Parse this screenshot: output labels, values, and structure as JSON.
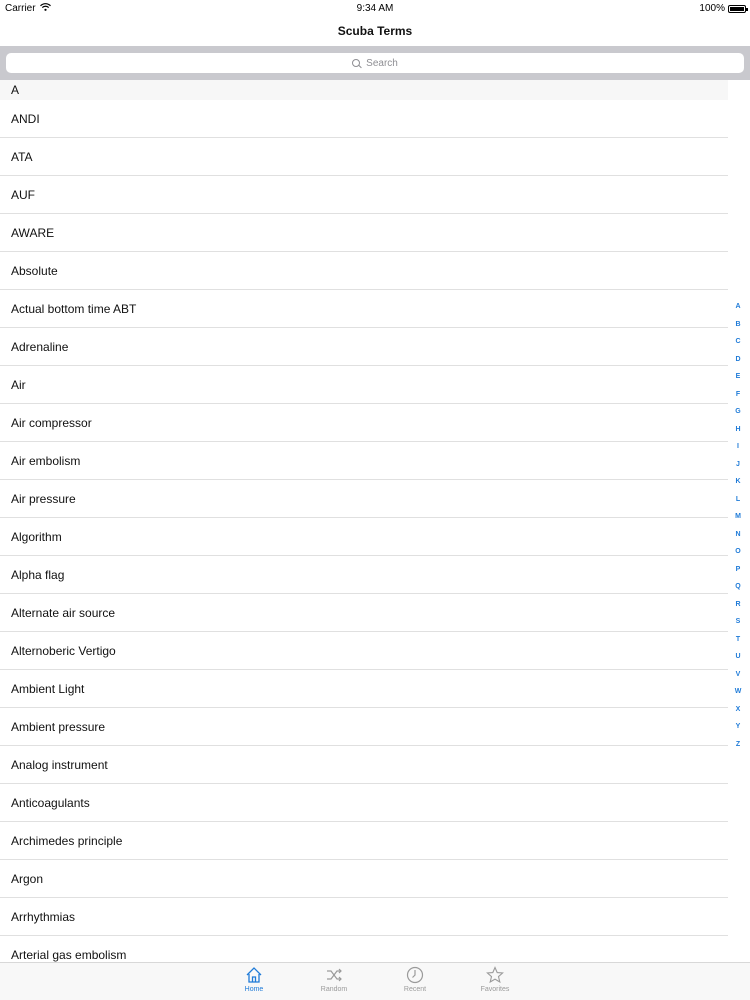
{
  "status_bar": {
    "carrier": "Carrier",
    "time": "9:34 AM",
    "battery": "100%",
    "battery_level": 1.0
  },
  "nav": {
    "title": "Scuba Terms"
  },
  "search": {
    "placeholder": "Search"
  },
  "section": {
    "header": "A"
  },
  "terms": [
    "ANDI",
    "ATA",
    "AUF",
    "AWARE",
    "Absolute",
    "Actual bottom time ABT",
    "Adrenaline",
    "Air",
    "Air compressor",
    "Air embolism",
    "Air pressure",
    "Algorithm",
    "Alpha flag",
    "Alternate air source",
    "Alternoberic Vertigo",
    "Ambient Light",
    "Ambient pressure",
    "Analog instrument",
    "Anticoagulants",
    "Archimedes principle",
    "Argon",
    "Arrhythmias",
    "Arterial gas embolism"
  ],
  "index_letters": [
    "A",
    "B",
    "C",
    "D",
    "E",
    "F",
    "G",
    "H",
    "I",
    "J",
    "K",
    "L",
    "M",
    "N",
    "O",
    "P",
    "Q",
    "R",
    "S",
    "T",
    "U",
    "V",
    "W",
    "X",
    "Y",
    "Z"
  ],
  "tabs": [
    {
      "label": "Home",
      "icon": "home-icon",
      "active": true
    },
    {
      "label": "Random",
      "icon": "shuffle-icon",
      "active": false
    },
    {
      "label": "Recent",
      "icon": "clock-icon",
      "active": false
    },
    {
      "label": "Favorites",
      "icon": "star-icon",
      "active": false
    }
  ],
  "colors": {
    "accent": "#1f7bd8",
    "inactive_tab": "#9a9a9a",
    "search_background": "#c9c9ce"
  }
}
